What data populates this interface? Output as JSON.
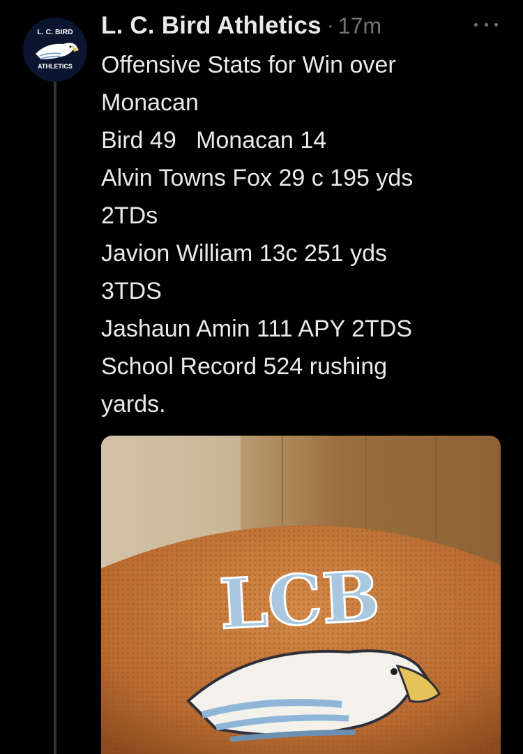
{
  "author": {
    "name": "L. C. Bird Athletics",
    "separator": "·",
    "timestamp": "17m",
    "avatar_top_text": "L. C. BIRD",
    "avatar_bottom_text": "ATHLETICS",
    "avatar_icon": "eagle-icon"
  },
  "more_icon": "more-horizontal-icon",
  "body_lines": [
    "Offensive Stats for Win over",
    "Monacan",
    "Bird 49   Monacan 14",
    "Alvin Towns Fox 29 c 195 yds",
    "2TDs",
    "Javion William 13c 251 yds",
    "3TDS",
    "Jashaun Amin 111 APY 2TDS",
    "School Record 524 rushing",
    "yards."
  ],
  "media": {
    "ball_text": "LCB",
    "ball_icon": "eagle-icon"
  },
  "colors": {
    "background": "#000000",
    "text": "#e7e9ea",
    "secondary": "#71767b",
    "thread_line": "#333639",
    "logo_blue": "#a9c8e0",
    "ball_orange": "#c4773a"
  }
}
